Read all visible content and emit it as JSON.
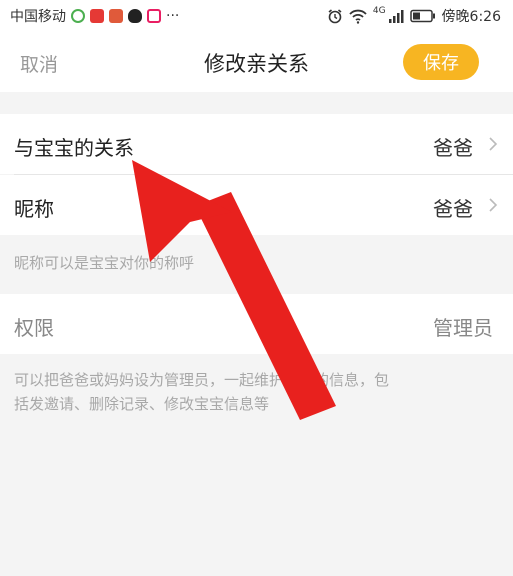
{
  "statusbar": {
    "carrier": "中国移动",
    "more": "···",
    "network": "4G",
    "time": "傍晚6:26"
  },
  "nav": {
    "cancel": "取消",
    "title": "修改亲关系",
    "save": "保存"
  },
  "relation": {
    "label": "与宝宝的关系",
    "value": "爸爸"
  },
  "nickname": {
    "label": "昵称",
    "value": "爸爸",
    "hint": "昵称可以是宝宝对你的称呼"
  },
  "permission": {
    "label": "权限",
    "value": "管理员",
    "hint_line1": "可以把爸爸或妈妈设为管理员，一起维护宝宝的信息，包",
    "hint_line2": "括发邀请、删除记录、修改宝宝信息等"
  },
  "colors": {
    "accent": "#f7b522",
    "annotation_arrow": "#e8211e"
  }
}
